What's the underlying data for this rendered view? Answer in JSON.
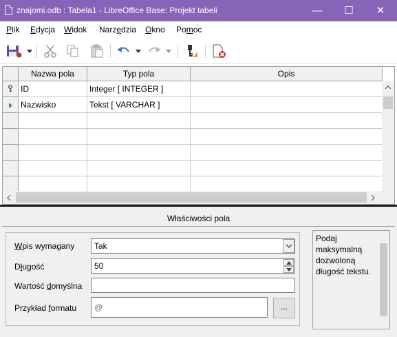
{
  "window": {
    "title": "znajomi.odb : Tabela1 - LibreOffice Base: Projekt tabeli",
    "minimize_glyph": "—",
    "maximize_glyph": "☐",
    "close_glyph": "✕"
  },
  "menubar": {
    "items": [
      {
        "accel": "P",
        "rest": "lik"
      },
      {
        "accel": "E",
        "rest": "dycja"
      },
      {
        "accel": "W",
        "rest": "idok"
      },
      {
        "pre": "Narz",
        "accel": "ę",
        "rest": "dzia"
      },
      {
        "accel": "O",
        "rest": "kno"
      },
      {
        "pre": "Po",
        "accel": "m",
        "rest": "oc"
      }
    ]
  },
  "toolbar": {
    "icons": [
      "save-icon",
      "cut-icon",
      "copy-icon",
      "paste-icon",
      "undo-icon",
      "redo-icon",
      "primary-key-icon",
      "close-document-icon"
    ],
    "accent": "#c0392b"
  },
  "grid": {
    "headers": [
      "Nazwa pola",
      "Typ pola",
      "Opis"
    ],
    "rows": [
      {
        "name": "ID",
        "type": "Integer [ INTEGER ]",
        "desc": "",
        "marker": "key"
      },
      {
        "name": "Nazwisko",
        "type": "Tekst [ VARCHAR ]",
        "desc": "",
        "marker": "current"
      },
      {
        "name": "",
        "type": "",
        "desc": ""
      },
      {
        "name": "",
        "type": "",
        "desc": ""
      },
      {
        "name": "",
        "type": "",
        "desc": ""
      },
      {
        "name": "",
        "type": "",
        "desc": ""
      },
      {
        "name": "",
        "type": "",
        "desc": ""
      }
    ]
  },
  "properties": {
    "title": "Właściwości pola",
    "required": {
      "accel": "W",
      "rest": "pis wymagany",
      "value": "Tak"
    },
    "length": {
      "pre": "D",
      "accel": "ł",
      "rest": "ugość",
      "value": "50"
    },
    "default": {
      "pre": "Wartość ",
      "accel": "d",
      "rest": "omyślna",
      "value": ""
    },
    "format": {
      "pre": "Przykład ",
      "accel": "f",
      "rest": "ormatu",
      "value": "@",
      "button": "..."
    },
    "help": "Podaj maksymalną dozwoloną długość tekstu."
  }
}
